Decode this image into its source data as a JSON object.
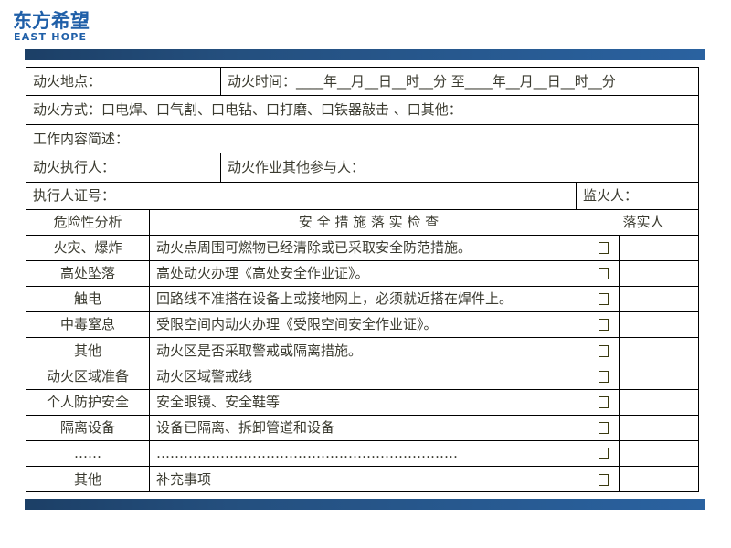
{
  "brand": {
    "name_cn": "东方希望",
    "name_en": "EAST HOPE",
    "color": "#1f5fa8",
    "bar_color_start": "#1c3f66",
    "bar_color_end": "#2a62a0"
  },
  "form": {
    "location_label": "动火地点：",
    "time_label": "动火时间：____年__月__日__时__分 至____年__月__日__时__分",
    "method_label": "动火方式：口电焊、口气割、口电钻、口打磨、口铁器敲击 、口其他：",
    "work_desc_label": "工作内容简述：",
    "executor_label": "动火执行人：",
    "participants_label": "动火作业其他参与人：",
    "executor_id_label": "执行人证号：",
    "fire_watcher_label": "监火人：",
    "headers": {
      "risk": "危险性分析",
      "measures": "安 全 措 施 落 实 检 查",
      "responsible": "落实人"
    },
    "rows": [
      {
        "risk": "火灾、爆炸",
        "measure": "动火点周围可燃物已经清除或已采取安全防范措施。",
        "checked": false
      },
      {
        "risk": "高处坠落",
        "measure": "高处动火办理《高处安全作业证》。",
        "checked": false
      },
      {
        "risk": "触电",
        "measure": "回路线不准搭在设备上或接地网上，必须就近搭在焊件上。",
        "checked": false
      },
      {
        "risk": "中毒窒息",
        "measure": "受限空间内动火办理《受限空间安全作业证》。",
        "checked": false
      },
      {
        "risk": "其他",
        "measure": "动火区是否采取警戒或隔离措施。",
        "checked": false
      },
      {
        "risk": "动火区域准备",
        "measure": "动火区域警戒线",
        "checked": false
      },
      {
        "risk": "个人防护安全",
        "measure": "安全眼镜、安全鞋等",
        "checked": false
      },
      {
        "risk": "隔离设备",
        "measure": "设备已隔离、拆卸管道和设备",
        "checked": false
      },
      {
        "risk": "……",
        "measure": "…………………………………………………………",
        "checked": false
      },
      {
        "risk": "其他",
        "measure": "补充事项",
        "checked": false
      }
    ]
  }
}
